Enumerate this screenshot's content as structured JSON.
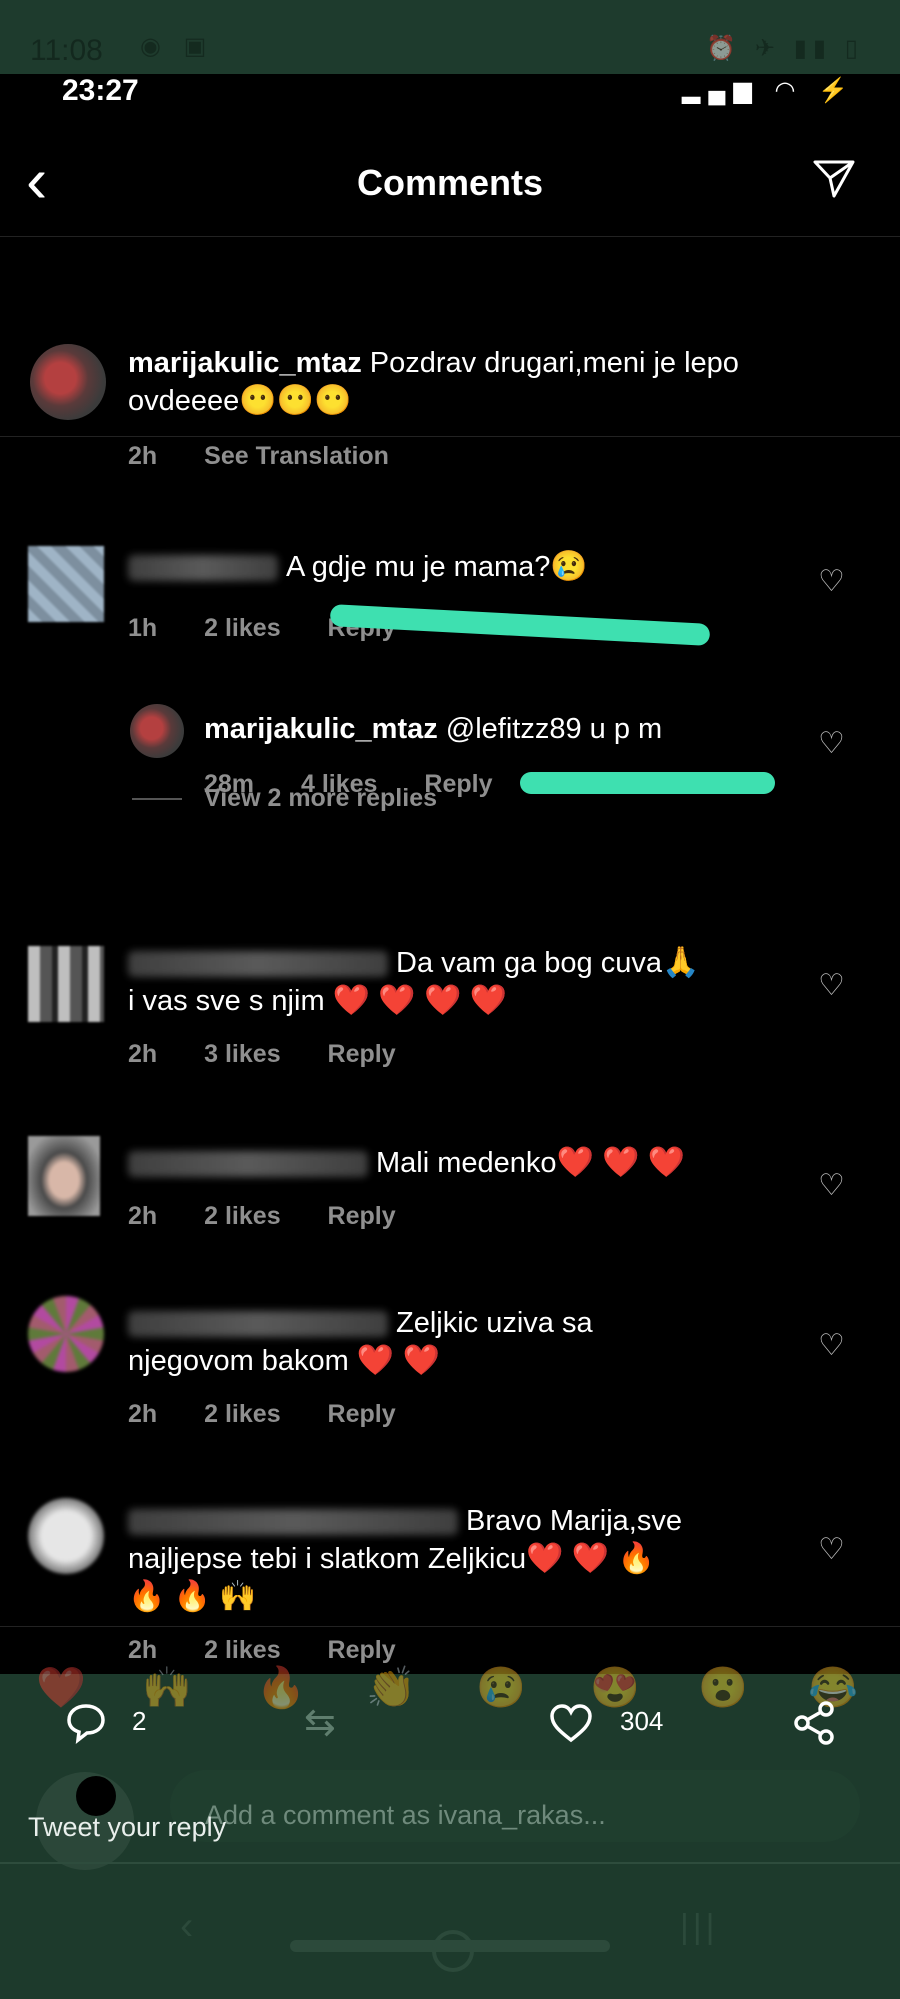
{
  "outer_status": {
    "time": "11:08"
  },
  "ig": {
    "status_time": "23:27",
    "title": "Comments",
    "caption": {
      "username": "marijakulic_mtaz",
      "text_line1": "Pozdrav drugari,meni je lepo",
      "text_line2": "ovdeeee",
      "emoji": "😶😶😶",
      "time": "2h",
      "see_translation": "See Translation"
    },
    "comments": [
      {
        "text": "A gdje mu je mama?",
        "emoji": "😢",
        "time": "1h",
        "likes": "2 likes",
        "reply": "Reply"
      },
      {
        "username": "marijakulic_mtaz",
        "text": "@lefitzz89 u p m",
        "time": "28m",
        "likes": "4 likes",
        "reply": "Reply"
      },
      {
        "text": "Da vam ga bog cuva",
        "emoji": "🙏",
        "text2": "i vas sve s njim",
        "emoji2": "❤️ ❤️ ❤️ ❤️",
        "time": "2h",
        "likes": "3 likes",
        "reply": "Reply"
      },
      {
        "text": "Mali medenko",
        "emoji": "❤️ ❤️ ❤️",
        "time": "2h",
        "likes": "2 likes",
        "reply": "Reply"
      },
      {
        "text": "Zeljkic uziva sa",
        "text2": "njegovom bakom",
        "emoji2": "❤️ ❤️",
        "time": "2h",
        "likes": "2 likes",
        "reply": "Reply"
      },
      {
        "text": "Bravo Marija,sve",
        "text2": "najljepse tebi i slatkom Zeljkicu",
        "emoji2": "❤️ ❤️ 🔥",
        "text3": "🔥 🔥 🙌",
        "time": "2h",
        "likes": "2 likes",
        "reply": "Reply"
      }
    ],
    "view_more": "View 2 more replies",
    "add_comment_placeholder": "Add a comment as ivana_rakas..."
  },
  "twitter": {
    "reply_count": "2",
    "like_count": "304",
    "reply_placeholder": "Tweet your reply",
    "reactions": [
      "❤️",
      "🙌",
      "🔥",
      "👏",
      "😢",
      "😍",
      "😮",
      "😂"
    ]
  }
}
